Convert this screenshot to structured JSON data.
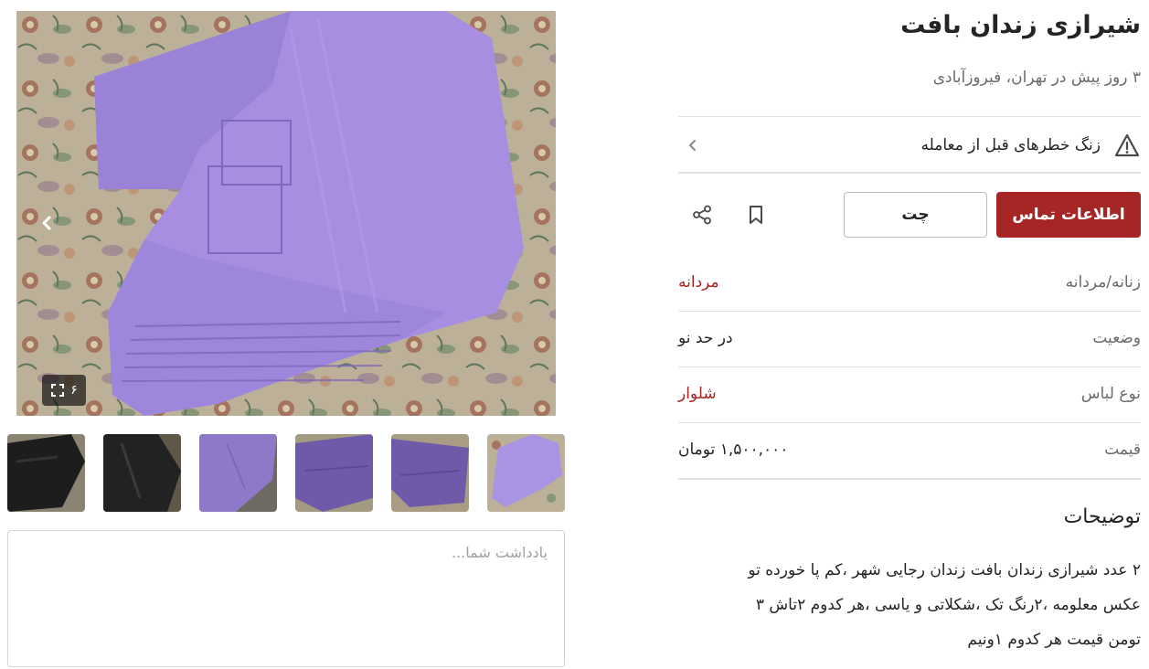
{
  "gallery": {
    "image_count": "۶",
    "next_icon": "chevron-left-icon",
    "fullscreen_icon": "expand-icon",
    "thumbnails": [
      {
        "name": "thumb-black-1",
        "color": "#1d1d1d"
      },
      {
        "name": "thumb-black-2",
        "color": "#222222"
      },
      {
        "name": "thumb-purple-1",
        "color": "#8e78c8"
      },
      {
        "name": "thumb-purple-2",
        "color": "#6e5aa8"
      },
      {
        "name": "thumb-purple-3",
        "color": "#6f5aa9"
      },
      {
        "name": "thumb-purple-4",
        "color": "#a994e4"
      }
    ],
    "note_placeholder": "یادداشت شما..."
  },
  "listing": {
    "title": "شیرازی زندان بافت",
    "subtitle": "۳ روز پیش در تهران، فیروزآبادی",
    "warning": "زنگ خطرهای قبل از معامله",
    "contact_button": "اطلاعات تماس",
    "chat_button": "چت",
    "bookmark_icon": "bookmark-icon",
    "share_icon": "share-icon",
    "attributes": [
      {
        "key": "زنانه/مردانه",
        "value": "مردانه",
        "link": true
      },
      {
        "key": "وضعیت",
        "value": "در حد نو",
        "link": false
      },
      {
        "key": "نوع لباس",
        "value": "شلوار",
        "link": true
      },
      {
        "key": "قیمت",
        "value": "۱,۵۰۰,۰۰۰ تومان",
        "link": false
      }
    ],
    "description_title": "توضیحات",
    "description_lines": [
      "۲ عدد شیرازی زندان بافت زندان رجایی شهر ،کم پا خورده تو",
      "عکس معلومه ،۲رنگ تک ،شکلاتی و یاسی ،هر کدوم ۲تاش ۳",
      "تومن قیمت هر کدوم ۱ونیم"
    ]
  },
  "colors": {
    "accent": "#a62626",
    "text": "#242424",
    "muted": "#6b6b6b",
    "product_purple": "#a78bdf"
  }
}
